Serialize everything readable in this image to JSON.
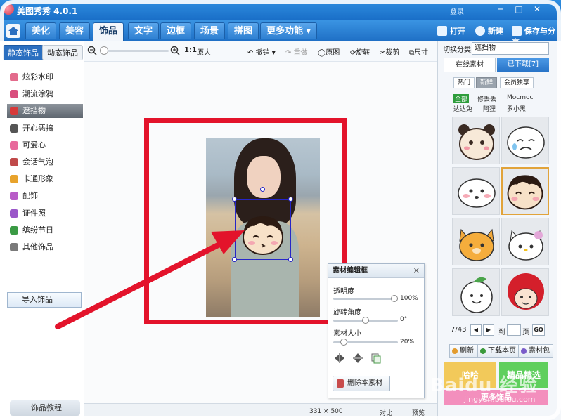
{
  "window": {
    "title": "美图秀秀 4.0.1",
    "top_link": "登录",
    "controls": [
      "─",
      "□",
      "✕"
    ]
  },
  "tabs": {
    "home_icon": "home-icon",
    "items": [
      "美化",
      "美容",
      "饰品",
      "文字",
      "边框",
      "场景",
      "拼图",
      "更多功能 ▾"
    ],
    "active": "饰品"
  },
  "header_actions": {
    "open": "打开",
    "new": "新建",
    "save_share": "保存与分享"
  },
  "toolbar": {
    "zoom_ratio": "1:1",
    "original_size": "原大",
    "undo": "撤销",
    "redo": "重做",
    "original_image": "原图",
    "rotate": "旋转",
    "crop": "裁剪",
    "size": "尺寸"
  },
  "left_panel": {
    "subtabs": [
      "静态饰品",
      "动态饰品"
    ],
    "categories": [
      {
        "label": "炫彩水印",
        "color": "#e36b8c"
      },
      {
        "label": "潮流涂鸦",
        "color": "#d94f7e"
      },
      {
        "label": "遮挡物",
        "color": "#d63a3a"
      },
      {
        "label": "开心恶搞",
        "color": "#555555"
      },
      {
        "label": "可爱心",
        "color": "#e86a9c"
      },
      {
        "label": "会话气泡",
        "color": "#c04a4a"
      },
      {
        "label": "卡通形象",
        "color": "#e8a32c"
      },
      {
        "label": "配饰",
        "color": "#b85cc7"
      },
      {
        "label": "证件照",
        "color": "#9a57c9"
      },
      {
        "label": "缤纷节日",
        "color": "#3a9a44"
      },
      {
        "label": "其他饰品",
        "color": "#7a7a7a"
      }
    ],
    "selected_index": 2,
    "import_label": "导入饰品",
    "tutorial_label": "饰品教程"
  },
  "edit_panel": {
    "title": "素材编辑框",
    "transparency_label": "透明度",
    "transparency_value": "100%",
    "transparency_level": 1.0,
    "rotation_label": "旋转角度",
    "rotation_value": "0°",
    "rotation_level": 0.5,
    "size_label": "素材大小",
    "size_value": "20%",
    "size_level": 0.12,
    "delete_label": "删除本素材"
  },
  "right_panel": {
    "switch_label": "切换分类",
    "switch_value": "遮挡物",
    "source_tabs": [
      "在线素材",
      "已下载[7]"
    ],
    "filters": [
      "热门",
      "新鲜",
      "会员独享"
    ],
    "active_filter": "新鲜",
    "sources": [
      "全部",
      "修丢丢",
      "Mocmoc",
      "达达兔",
      "阿狸",
      "罗小黑"
    ],
    "active_source": "全部",
    "thumbnails": [
      "panda-face-sticker",
      "crying-face-sticker",
      "blushing-face-sticker",
      "girl-face-sticker",
      "cat-face-sticker",
      "hello-kitty-sticker",
      "leaf-face-sticker",
      "red-hair-sticker"
    ],
    "selected_thumbnail": 3,
    "page_current": "7",
    "page_total": "/43",
    "goto_label": "到",
    "page_unit": "页",
    "go_label": "GO",
    "refresh_label": "刷新",
    "download_page_label": "下载本页",
    "material_pack_label": "素材包",
    "promo_1": "哈哈",
    "promo_2": "精品精选",
    "promo_3": "更多饰品"
  },
  "status_bar": {
    "size": "331 × 500",
    "compare": "对比",
    "preview": "预览"
  },
  "watermark": {
    "brand": "Baidu 经验",
    "url": "jingyan.baidu.com"
  },
  "colors": {
    "accent_blue": "#1f70c6",
    "annotation_red": "#e3132b",
    "selection_blue": "#2626c8"
  }
}
